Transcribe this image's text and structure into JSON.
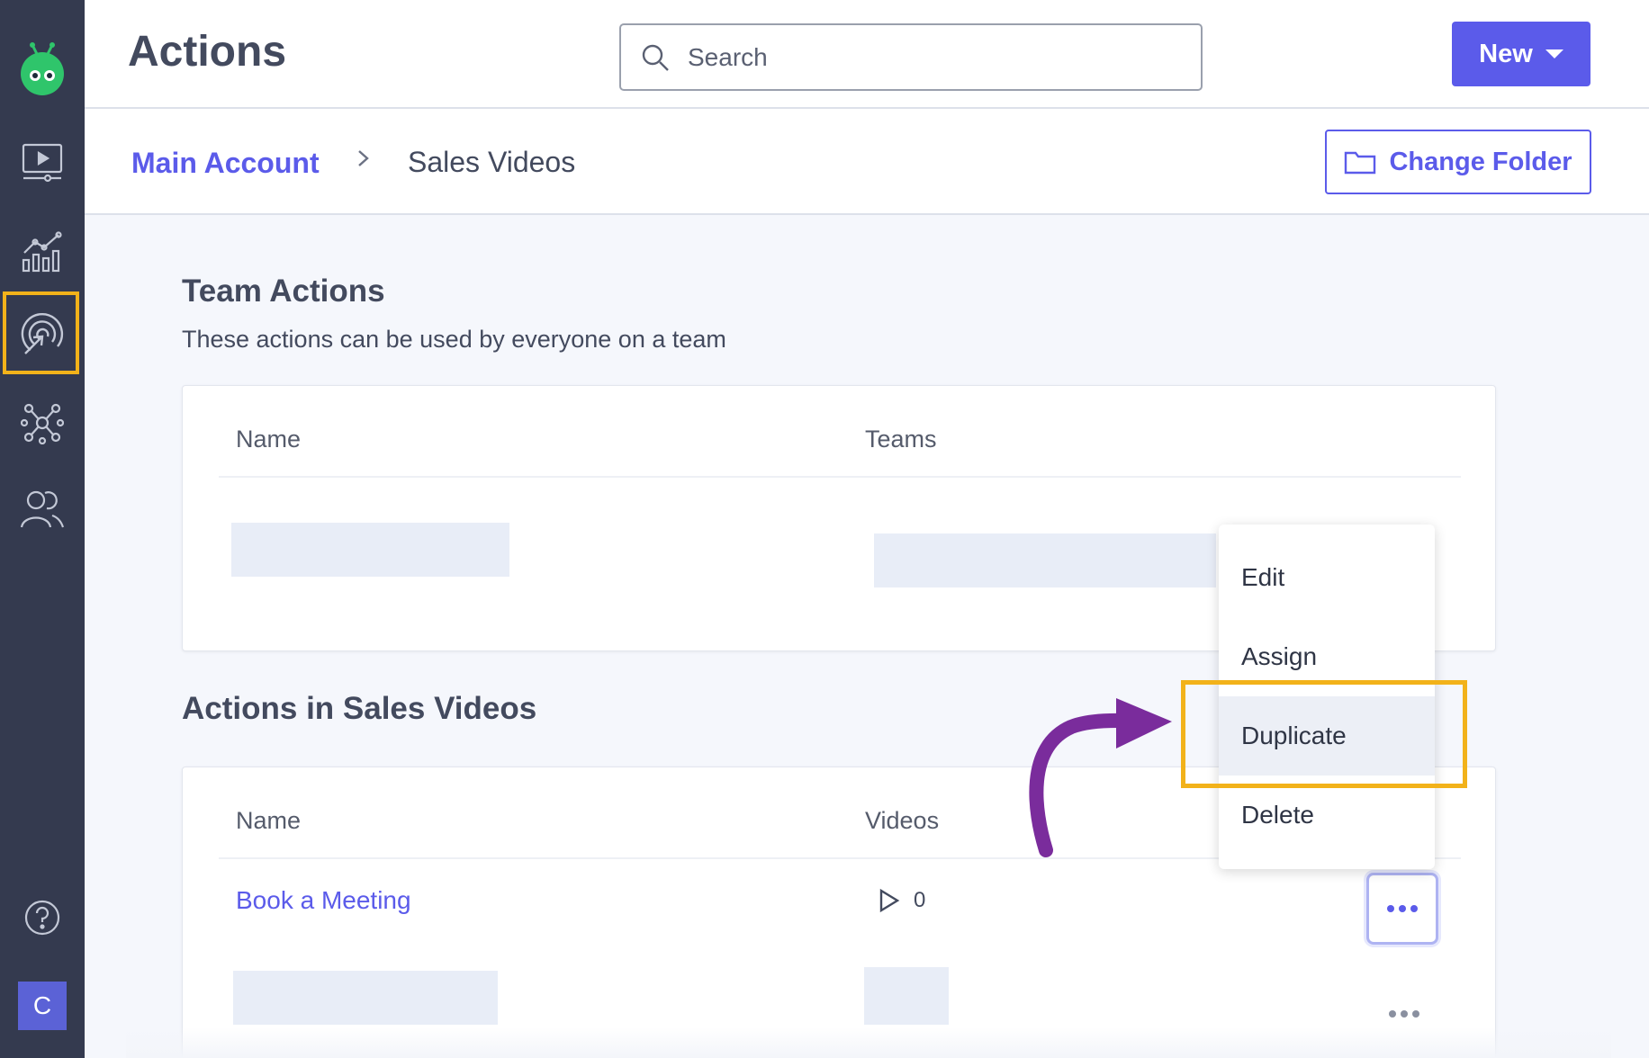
{
  "app": {
    "brand_colors": {
      "primary": "#5b5bea",
      "sidebar": "#343a4f",
      "highlight": "#f2b21a",
      "annotation_arrow": "#7a2c9c"
    }
  },
  "sidebar": {
    "items": [
      {
        "icon": "robot-logo-icon"
      },
      {
        "icon": "video-player-icon"
      },
      {
        "icon": "analytics-chart-icon"
      },
      {
        "icon": "actions-target-icon",
        "selected": true
      },
      {
        "icon": "integrations-network-icon"
      },
      {
        "icon": "contacts-people-icon"
      }
    ],
    "help_icon": "question-circle-icon",
    "avatar_initial": "C"
  },
  "header": {
    "title": "Actions",
    "search_placeholder": "Search",
    "new_button_label": "New"
  },
  "breadcrumb": {
    "root": "Main Account",
    "current": "Sales Videos",
    "change_folder_label": "Change Folder"
  },
  "team_actions": {
    "title": "Team Actions",
    "subtitle": "These actions can be used by everyone on a team",
    "columns": [
      "Name",
      "Teams"
    ]
  },
  "folder_actions": {
    "title": "Actions in Sales Videos",
    "columns": [
      "Name",
      "Videos"
    ],
    "rows": [
      {
        "name": "Book a Meeting",
        "videos": "0"
      }
    ]
  },
  "row_menu": {
    "items": [
      "Edit",
      "Assign",
      "Duplicate",
      "Delete"
    ],
    "highlighted": "Duplicate"
  }
}
